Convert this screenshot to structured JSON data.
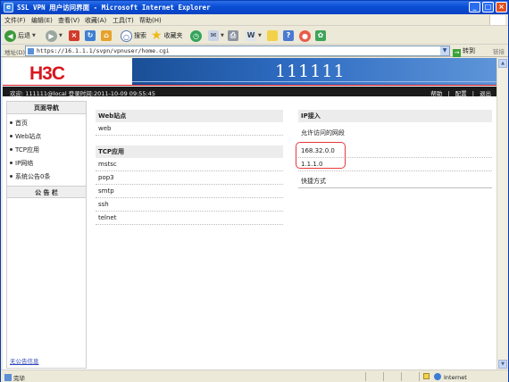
{
  "window": {
    "title": "SSL VPN 用户访问界面 - Microsoft Internet Explorer"
  },
  "menu": [
    "文件(F)",
    "编辑(E)",
    "查看(V)",
    "收藏(A)",
    "工具(T)",
    "帮助(H)"
  ],
  "toolbar": {
    "back": "后退",
    "search": "搜索",
    "favorites": "收藏夹"
  },
  "address": {
    "label": "地址(D)",
    "url": "https://16.1.1.1/svpn/vpnuser/home.cgi",
    "go": "转到",
    "links": "链接"
  },
  "banner": {
    "logo": "H3C",
    "account": "111111"
  },
  "session": {
    "welcome": "欢迎: 111111@local   登录时间:2011-10-09 09:55:45",
    "help": "帮助",
    "config": "配置",
    "logout": "退出",
    "sep": "|"
  },
  "sidebar": {
    "nav_title": "页面导航",
    "items": [
      "首页",
      "Web站点",
      "TCP应用",
      "IP网络",
      "系统公告0条"
    ],
    "bulletin_title": "公 告 栏",
    "footer": "无公告信息"
  },
  "web_panel": {
    "title": "Web站点",
    "items": [
      "web"
    ]
  },
  "tcp_panel": {
    "title": "TCP应用",
    "items": [
      "mstsc",
      "pop3",
      "smtp",
      "ssh",
      "telnet"
    ]
  },
  "ip_panel": {
    "title": "IP接入",
    "allowed_label": "允许访问的网段",
    "subnets": [
      "168.32.0.0",
      "1.1.1.0"
    ],
    "shortcuts": "快捷方式"
  },
  "statusbar": {
    "done": "完毕",
    "zone": "Internet"
  },
  "colors": {
    "brand_red": "#d9161e",
    "banner_blue": "#2f6cc2",
    "highlight": "#e6393a"
  }
}
